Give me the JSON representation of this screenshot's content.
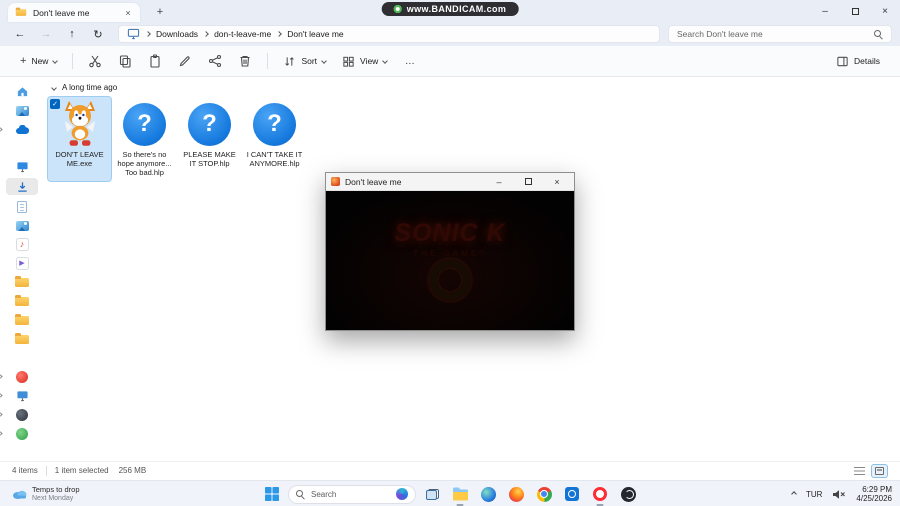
{
  "window": {
    "tab_title": "Don't leave me",
    "watermark": "www.BANDICAM.com"
  },
  "icons": {
    "close": "×",
    "minimize": "–",
    "new_tab": "+",
    "plus": "+",
    "back": "←",
    "forward": "→",
    "up": "↑",
    "refresh": "↻",
    "more": "…",
    "check": "✓",
    "help": "?",
    "music_note": "♪",
    "play": "▶"
  },
  "colors": {
    "selection": "#cbe4f9",
    "accent": "#0067c0",
    "help_icon_blue": "#1478dd"
  },
  "nav": {
    "breadcrumb": [
      "Downloads",
      "don-t-leave-me",
      "Don't leave me"
    ],
    "search_placeholder": "Search Don't leave me"
  },
  "toolbar": {
    "new_label": "New",
    "sort_label": "Sort",
    "view_label": "View",
    "details_label": "Details"
  },
  "files": {
    "group_label": "A long time ago",
    "items": [
      {
        "name": "DON'T LEAVE ME.exe",
        "type": "exe",
        "selected": true
      },
      {
        "name": "So there's no hope anymore... Too bad.hlp",
        "type": "hlp",
        "selected": false
      },
      {
        "name": "PLEASE MAKE IT STOP.hlp",
        "type": "hlp",
        "selected": false
      },
      {
        "name": "I CAN'T TAKE IT ANYMORE.hlp",
        "type": "hlp",
        "selected": false
      }
    ]
  },
  "game_window": {
    "title": "Don't leave me",
    "logo_text": "SONIC K",
    "logo_subtext": "THE GAME?"
  },
  "status_bar": {
    "items_count": "4 items",
    "selection": "1 item selected",
    "size": "256 MB"
  },
  "taskbar": {
    "weather_primary": "Temps to drop",
    "weather_secondary": "Next Monday",
    "search_label": "Search",
    "tray": {
      "language": "TUR",
      "time": "6:29 PM",
      "date": "4/25/2026"
    }
  }
}
